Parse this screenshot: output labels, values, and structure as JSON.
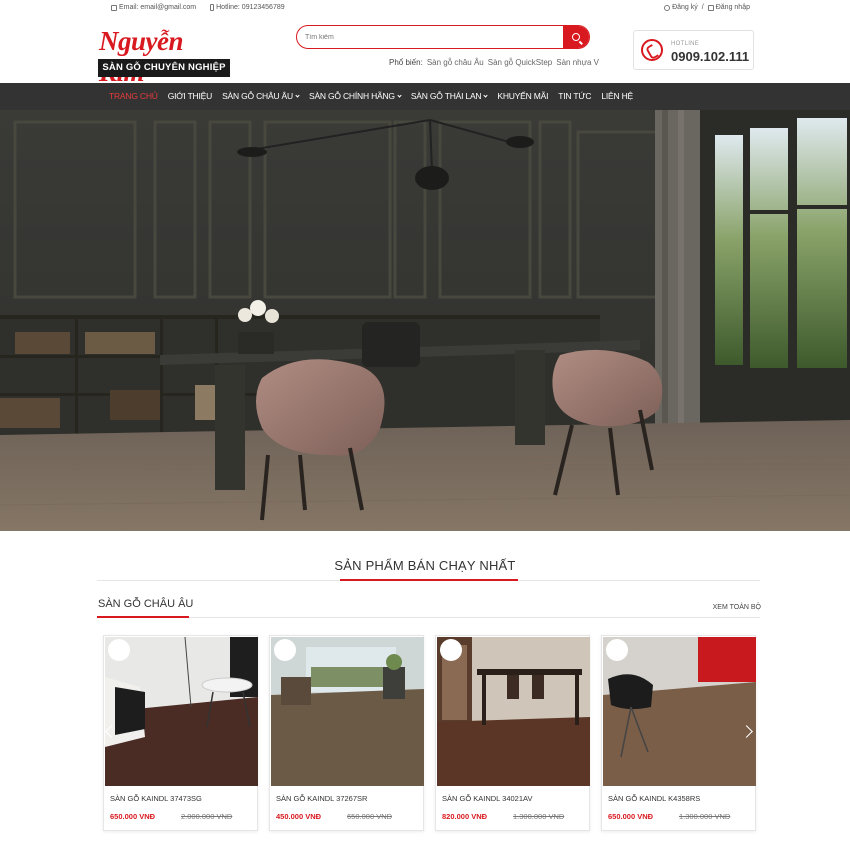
{
  "topbar": {
    "email": "Email: email@gmail.com",
    "hotline": "Hotline: 09123456789",
    "register": "Đăng ký",
    "separator": "/",
    "login": "Đăng nhập"
  },
  "header": {
    "logo_brand": "Nguyễn Kim",
    "logo_slogan": "SÀN GỖ CHUYÊN NGHIỆP",
    "search_placeholder": "Tìm kiếm",
    "popular_label": "Phổ biến:",
    "popular_links": [
      "Sàn gỗ châu Âu",
      "Sàn gỗ QuickStep",
      "Sàn nhựa V"
    ],
    "hotline_label": "HOTLINE",
    "hotline_number": "0909.102.111"
  },
  "nav": {
    "items": [
      {
        "label": "Trang chủ",
        "active": true,
        "dropdown": false
      },
      {
        "label": "Giới thiệu",
        "active": false,
        "dropdown": false
      },
      {
        "label": "Sàn gỗ châu Âu",
        "active": false,
        "dropdown": true
      },
      {
        "label": "Sàn gỗ chính hãng",
        "active": false,
        "dropdown": true
      },
      {
        "label": "Sàn gỗ Thái Lan",
        "active": false,
        "dropdown": true
      },
      {
        "label": "Khuyến mãi",
        "active": false,
        "dropdown": false
      },
      {
        "label": "Tin tức",
        "active": false,
        "dropdown": false
      },
      {
        "label": "Liên hệ",
        "active": false,
        "dropdown": false
      }
    ]
  },
  "section": {
    "title": "SẢN PHẨM BÁN CHẠY NHẤT",
    "category_title": "SÀN GỖ CHÂU ÂU",
    "view_all": "XEM TOÀN BỘ"
  },
  "products": [
    {
      "name": "SÀN GỖ KAINDL 37473SG",
      "price": "650.000 VNĐ",
      "old_price": "2.000.000 VNĐ"
    },
    {
      "name": "SÀN GỖ KAINDL 37267SR",
      "price": "450.000 VNĐ",
      "old_price": "650.000 VNĐ"
    },
    {
      "name": "SÀN GỖ KAINDL 34021AV",
      "price": "820.000 VNĐ",
      "old_price": "1.300.000 VNĐ"
    },
    {
      "name": "SÀN GỖ KAINDL K4358RS",
      "price": "650.000 VNĐ",
      "old_price": "1.300.000 VNĐ"
    }
  ],
  "colors": {
    "brand_red": "#d8191f",
    "nav_bg": "#333333",
    "nav_active": "#e53b3b"
  }
}
